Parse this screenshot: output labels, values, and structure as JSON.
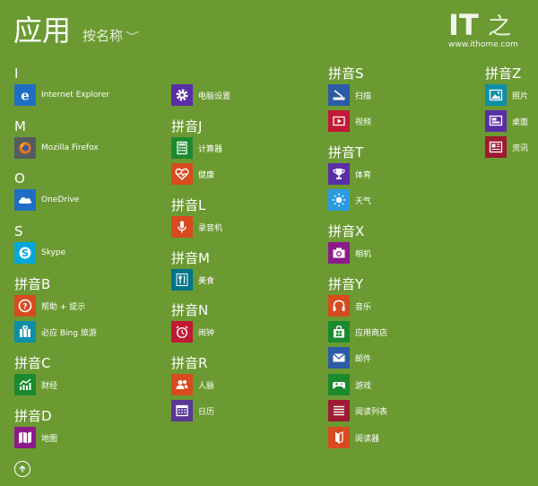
{
  "title": "应用",
  "sort_label": "按名称",
  "sort_chevron": "﹀",
  "watermark": {
    "brand": "IT之家",
    "url": "www.ithome.com"
  },
  "groups": {
    "I": "I",
    "M": "M",
    "O": "O",
    "S": "S",
    "B": "拼音B",
    "C": "拼音C",
    "D": "拼音D",
    "J": "拼音J",
    "L": "拼音L",
    "PM": "拼音M",
    "N": "拼音N",
    "R": "拼音R",
    "PS": "拼音S",
    "T": "拼音T",
    "X": "拼音X",
    "Y": "拼音Y",
    "Z": "拼音Z"
  },
  "apps": {
    "ie": "Internet Explorer",
    "firefox": "Mozilla Firefox",
    "onedrive": "OneDrive",
    "skype": "Skype",
    "help": "帮助 + 提示",
    "bing_travel": "必应 Bing 旅游",
    "finance": "财经",
    "maps": "地图",
    "pc_settings": "电脑设置",
    "calculator": "计算器",
    "health": "健康",
    "recorder": "录音机",
    "food": "美食",
    "alarms": "闹钟",
    "people": "人脉",
    "calendar": "日历",
    "scan": "扫描",
    "video": "视频",
    "sports": "体育",
    "weather": "天气",
    "camera": "相机",
    "music": "音乐",
    "store": "应用商店",
    "mail": "邮件",
    "games": "游戏",
    "reading_list": "阅读列表",
    "reader": "阅读器",
    "photos": "照片",
    "desktop": "桌面",
    "news": "资讯"
  },
  "tile_colors": {
    "blue": "#1e6fc4",
    "orange": "#d74b1f",
    "teal": "#0f8ea8",
    "purple": "#5a2ea6",
    "green": "#1b8a2e",
    "red": "#c21934",
    "darkred": "#9e1b32",
    "indigo": "#5a3896",
    "navy": "#2b5ba7",
    "grey": "#555c60",
    "sky": "#2a9be0",
    "cyan": "#01a8d9",
    "magenta": "#8c1a8c",
    "teal2": "#00748b"
  }
}
